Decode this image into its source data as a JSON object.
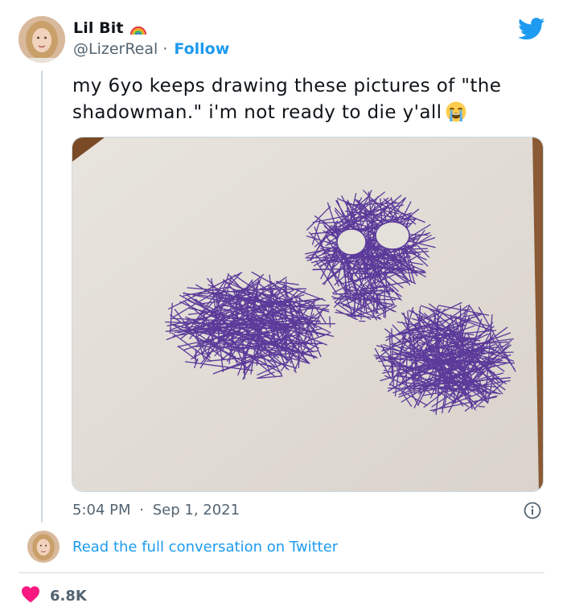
{
  "author": {
    "display_name": "Lil Bit",
    "handle": "@LizerReal",
    "separator": "·",
    "follow_label": "Follow"
  },
  "tweet": {
    "text": "my 6yo keeps drawing these pictures of \"the shadowman.\" i'm not ready to die y'all",
    "emoji": "loudly-crying-face",
    "time": "5:04 PM",
    "separator": "·",
    "date": "Sep 1, 2021"
  },
  "footer": {
    "read_more_label": "Read the full conversation on Twitter",
    "like_count": "6.8K"
  },
  "icons": {
    "brand": "twitter-bird-icon",
    "badge": "rainbow-icon",
    "info": "info-icon",
    "like": "heart-icon"
  },
  "colors": {
    "link": "#1d9bf0",
    "secondary_text": "#536471",
    "like": "#f91880",
    "crayon": "#5b3a9a"
  }
}
